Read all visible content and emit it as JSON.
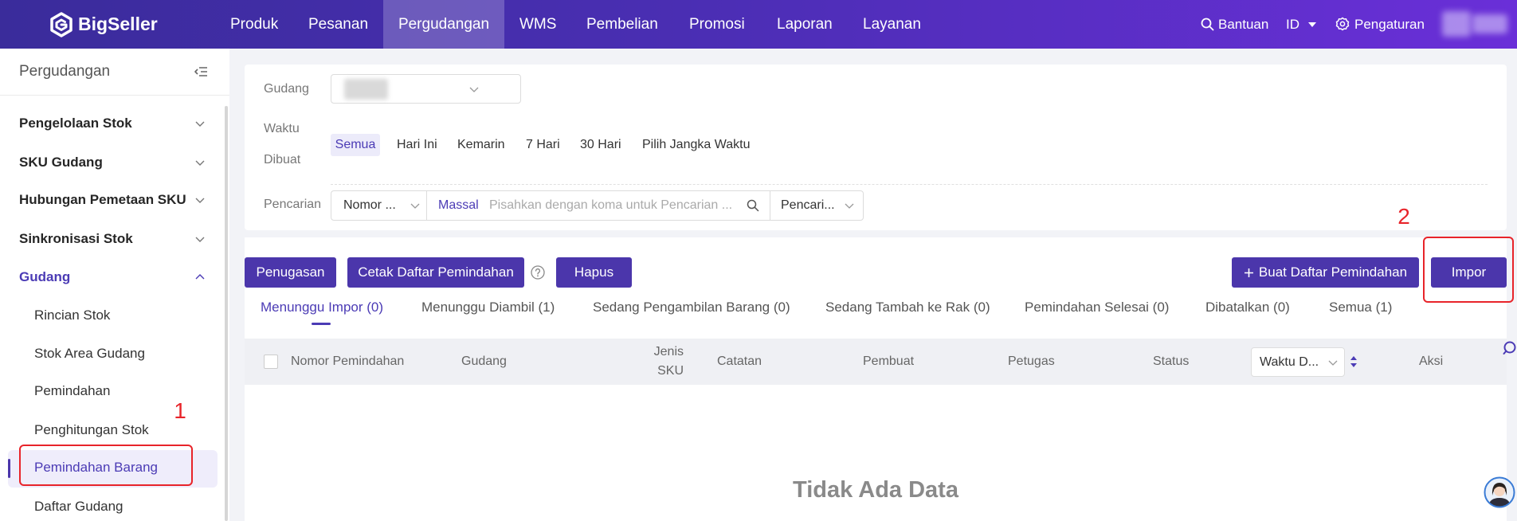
{
  "app": {
    "logo_text": "BigSeller"
  },
  "topnav": {
    "items": [
      {
        "label": "Produk"
      },
      {
        "label": "Pesanan"
      },
      {
        "label": "Pergudangan",
        "active": true
      },
      {
        "label": "WMS"
      },
      {
        "label": "Pembelian"
      },
      {
        "label": "Promosi"
      },
      {
        "label": "Laporan"
      },
      {
        "label": "Layanan"
      }
    ],
    "help_label": "Bantuan",
    "language": "ID",
    "settings_label": "Pengaturan"
  },
  "sidebar": {
    "title": "Pergudangan",
    "menu": [
      {
        "label": "Pengelolaan Stok",
        "expanded": false
      },
      {
        "label": "SKU Gudang",
        "expanded": false
      },
      {
        "label": "Hubungan Pemetaan SKU",
        "expanded": false
      },
      {
        "label": "Sinkronisasi Stok",
        "expanded": false
      },
      {
        "label": "Gudang",
        "expanded": true,
        "children": [
          {
            "label": "Rincian Stok"
          },
          {
            "label": "Stok Area Gudang"
          },
          {
            "label": "Pemindahan"
          },
          {
            "label": "Penghitungan Stok"
          },
          {
            "label": "Pemindahan Barang",
            "active": true
          },
          {
            "label": "Daftar Gudang"
          }
        ]
      }
    ]
  },
  "filters": {
    "warehouse_label": "Gudang",
    "created_time_label": "Waktu Dibuat",
    "time_options": [
      {
        "label": "Semua",
        "selected": true
      },
      {
        "label": "Hari Ini"
      },
      {
        "label": "Kemarin"
      },
      {
        "label": "7 Hari"
      },
      {
        "label": "30 Hari"
      },
      {
        "label": "Pilih Jangka Waktu"
      }
    ],
    "search_label": "Pencarian",
    "search_field_select": "Nomor ...",
    "bulk_label": "Massal",
    "search_placeholder": "Pisahkan dengan koma untuk Pencarian ...",
    "search_type_select": "Pencari..."
  },
  "actions": {
    "assign": "Penugasan",
    "print_list": "Cetak Daftar Pemindahan",
    "delete": "Hapus",
    "create_list": "Buat Daftar Pemindahan",
    "import": "Impor"
  },
  "tabs": [
    {
      "label": "Menunggu Impor (0)",
      "active": true
    },
    {
      "label": "Menunggu Diambil (1)"
    },
    {
      "label": "Sedang Pengambilan Barang (0)"
    },
    {
      "label": "Sedang Tambah ke Rak (0)"
    },
    {
      "label": "Pemindahan Selesai (0)"
    },
    {
      "label": "Dibatalkan (0)"
    },
    {
      "label": "Semua (1)"
    }
  ],
  "table": {
    "columns": [
      "Nomor Pemindahan",
      "Gudang",
      "Jenis SKU",
      "Catatan",
      "Pembuat",
      "Petugas",
      "Status",
      "Waktu D...",
      "Aksi"
    ],
    "empty_text": "Tidak Ada Data"
  },
  "annotations": {
    "step_1": "1",
    "step_2": "2"
  },
  "colors": {
    "primary": "#4b36ab",
    "active_text": "#4b3bb5",
    "nav_gradient_start": "#3a2c9b",
    "nav_gradient_end": "#6a2fd8",
    "annotation": "#e8242a"
  },
  "icons": [
    "bigseller-logo-icon",
    "search-icon",
    "caret-down-icon",
    "gear-icon",
    "collapse-menu-icon",
    "chevron-down-icon",
    "chevron-up-icon",
    "help-icon",
    "plus-icon",
    "sort-icon",
    "support-avatar-icon"
  ]
}
